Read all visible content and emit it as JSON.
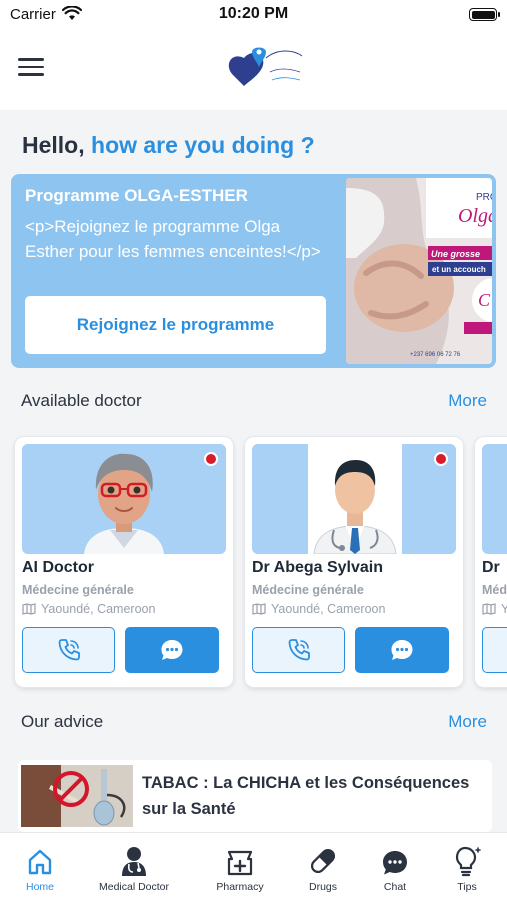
{
  "status_bar": {
    "carrier": "Carrier",
    "time": "10:20 PM"
  },
  "greeting": {
    "hello": "Hello,",
    "question": "how are you doing ?"
  },
  "banner": {
    "title": "Programme OLGA-ESTHER",
    "description": "<p>Rejoignez le programme Olga Esther pour les femmes enceintes!</p>",
    "button_label": "Rejoignez le programme",
    "image": {
      "logo_text": "Olga",
      "line1": "Une grosse",
      "line2": "et un accouch",
      "phone": "+237 696 06 72 76"
    }
  },
  "doctors_section": {
    "title": "Available doctor",
    "more_label": "More"
  },
  "doctors": [
    {
      "name": "AI Doctor",
      "specialty": "Médecine générale",
      "location": "Yaoundé, Cameroon",
      "online": true
    },
    {
      "name": "Dr Abega Sylvain",
      "specialty": "Médecine générale",
      "location": "Yaoundé, Cameroon",
      "online": true
    },
    {
      "name": "Dr",
      "specialty": "Méd",
      "location": "Y",
      "online": true
    }
  ],
  "advice_section": {
    "title": "Our advice",
    "more_label": "More"
  },
  "advice": [
    {
      "title": "TABAC : La CHICHA et les Conséquences sur la Santé"
    }
  ],
  "tabs": [
    {
      "label": "Home",
      "icon": "home-icon",
      "active": true
    },
    {
      "label": "Medical Doctor",
      "icon": "doctor-icon",
      "active": false
    },
    {
      "label": "Pharmacy",
      "icon": "pharmacy-icon",
      "active": false
    },
    {
      "label": "Drugs",
      "icon": "pill-icon",
      "active": false
    },
    {
      "label": "Chat",
      "icon": "chat-icon",
      "active": false
    },
    {
      "label": "Tips",
      "icon": "lightbulb-icon",
      "active": false
    }
  ],
  "colors": {
    "primary": "#2b8fe0",
    "banner": "#8ec5f0",
    "online": "#d91b2a"
  }
}
